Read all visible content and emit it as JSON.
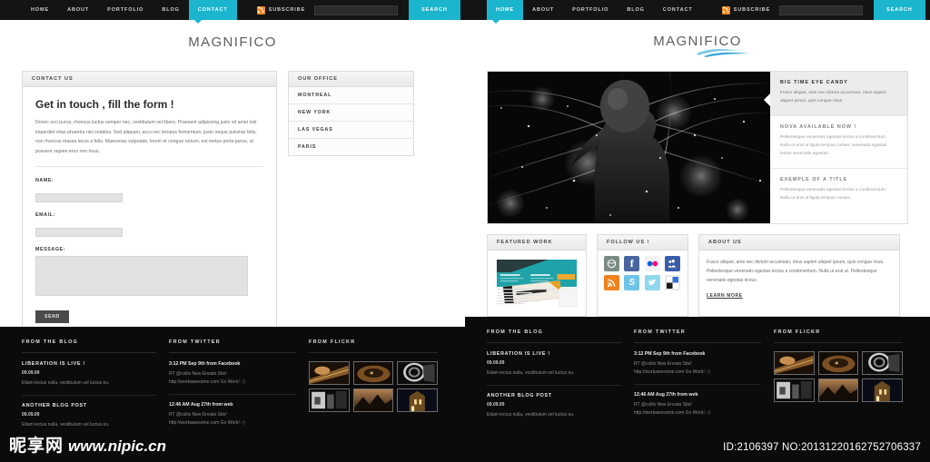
{
  "theme": {
    "accent": "#1bb5ce",
    "nav_bg": "#141414",
    "footer_bg": "#0b0b0b",
    "rss_orange": "#f08a24"
  },
  "nav": {
    "items_left": [
      {
        "label": "HOME",
        "active": false
      },
      {
        "label": "ABOUT",
        "active": false
      },
      {
        "label": "PORTFOLIO",
        "active": false
      },
      {
        "label": "BLOG",
        "active": false
      },
      {
        "label": "CONTACT",
        "active": true
      }
    ],
    "items_right": [
      {
        "label": "HOME",
        "active": true
      },
      {
        "label": "ABOUT",
        "active": false
      },
      {
        "label": "PORTFOLIO",
        "active": false
      },
      {
        "label": "BLOG",
        "active": false
      },
      {
        "label": "CONTACT",
        "active": false
      }
    ],
    "subscribe_label": "SUBSCRIBE",
    "search_value": "",
    "search_placeholder": "",
    "search_button": "SEARCH"
  },
  "logo": {
    "text": "MAGNIFICO"
  },
  "contact": {
    "panel_title": "CONTACT US",
    "heading": "Get in touch , fill the form !",
    "paragraph": "Donec orci purus, rhoncus luctus semper nec, vestibulum vel libero. Praesent adipiscing justo sit amet nisl imperdiet vitae pharetra nisl sodales. Sed aliquam, arcu nec tempus fermentum, justo neque pulvinar felis, non rhoncus massa lacus a felis. Maecenas vulputate, lorem et congue rutrum, est metus porta purus, ut posuere sapien eros non risus.",
    "form": {
      "name_label": "NAME:",
      "name_value": "",
      "email_label": "EMAIL:",
      "email_value": "",
      "message_label": "MESSAGE:",
      "message_value": "",
      "submit_label": "SEND"
    }
  },
  "office": {
    "panel_title": "OUR OFFICE",
    "locations": [
      "MONTREAL",
      "NEW YORK",
      "LAS VEGAS",
      "PARIS"
    ]
  },
  "slider": {
    "slides": [
      {
        "title": "BIG TIME EYE CANDY",
        "desc": "Fusce aliquet, ante nec dictum accumsan, risus sapien aliquet ipsum, quis congue risus",
        "active": true
      },
      {
        "title": "NOVA AVAILABLE NOW !",
        "desc": "Pellentesque venenatis egestas lectus a condimentum. Nulla ut erat ut ligula tempus consec venenatis egestas lectus venenatis egestas.",
        "active": false
      },
      {
        "title": "EXEMPLE OF A TITLE",
        "desc": "Pellentesque venenatis egestas lectus a condimentum. Nulla ut erat ut ligula tempus consec.",
        "active": false
      }
    ]
  },
  "boxes": {
    "featured": {
      "title": "FEATURED WORK",
      "thumb_label": "ROCKABLE"
    },
    "follow": {
      "title": "FOLLOW US !",
      "icons": [
        {
          "name": "dribbble-icon",
          "glyph": "●",
          "bg": "#7a8b84"
        },
        {
          "name": "facebook-icon",
          "glyph": "f",
          "bg": "#4a66a0"
        },
        {
          "name": "flickr-icon",
          "glyph": "●●",
          "bg": "#f2f2f2"
        },
        {
          "name": "myspace-icon",
          "glyph": "■",
          "bg": "#3b5ca8"
        },
        {
          "name": "rss-icon",
          "glyph": "●",
          "bg": "#f0821e"
        },
        {
          "name": "skype-icon",
          "glyph": "S",
          "bg": "#6ec4e8"
        },
        {
          "name": "twitter-icon",
          "glyph": "t",
          "bg": "#8fd8ee"
        },
        {
          "name": "delicious-icon",
          "glyph": "■",
          "bg": "#e8e8e8"
        }
      ]
    },
    "about": {
      "title": "ABOUT US",
      "text": "Fusce aliquet, ante nec dictum accumsan, risus sapien aliquet ipsum, quis congue risus. Pellentesque venenatis egestas lectus a condimentum. Nulla ut erat ut. Pellentesque venenatis egestas lectus.",
      "link_label": "LEARN MORE"
    }
  },
  "footer": {
    "blog": {
      "title": "FROM THE BLOG",
      "entries": [
        {
          "title": "LIBERATION IS LIVE !",
          "date": "09.09.09",
          "excerpt": "Etiam lectus nulla, vestibulum vel luctus eu."
        },
        {
          "title": "ANOTHER BLOG POST",
          "date": "09.09.09",
          "excerpt": "Etiam lectus nulla, vestibulum vel luctus eu."
        }
      ]
    },
    "twitter": {
      "title": "FROM TWITTER",
      "entries": [
        {
          "head": "3:12 PM Sep 9th from Facebook",
          "line1": "RT @collis New Envato Site!",
          "line2": "http://workawesome.com Go Work! :-)"
        },
        {
          "head": "12:46 AM Aug 27th from web",
          "line1": "RT @collis New Envato Site!",
          "line2": "http://workawesome.com Go Work! :-)"
        }
      ]
    },
    "flickr": {
      "title": "FROM FLICKR",
      "thumbs": [
        {
          "name": "flickr-thumb-1"
        },
        {
          "name": "flickr-thumb-2"
        },
        {
          "name": "flickr-thumb-3"
        },
        {
          "name": "flickr-thumb-4"
        },
        {
          "name": "flickr-thumb-5"
        },
        {
          "name": "flickr-thumb-6"
        }
      ]
    }
  },
  "watermark": {
    "cn_text": "昵享网",
    "url_text": "www.nipic.cn",
    "id_text": "ID:2106397 NO:20131220162752706337"
  }
}
